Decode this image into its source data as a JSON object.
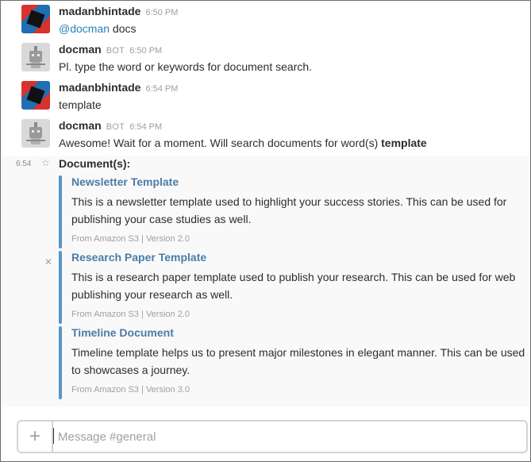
{
  "messages": [
    {
      "author": "madanbhintade",
      "time": "6:50 PM",
      "mention": "@docman",
      "text": " docs"
    },
    {
      "author": "docman",
      "badge": "BOT",
      "time": "6:50 PM",
      "text": "Pl. type the word or keywords for document search."
    },
    {
      "author": "madanbhintade",
      "time": "6:54 PM",
      "text": "template"
    },
    {
      "author": "docman",
      "badge": "BOT",
      "time": "6:54 PM",
      "text": "Awesome! Wait for a moment. Will search documents for word(s) ",
      "bold": "template"
    }
  ],
  "followup": {
    "time": "6:54",
    "star_icon": "star-icon",
    "label": "Document(s):",
    "close_icon": "close-icon"
  },
  "attachments": [
    {
      "title": "Newsletter Template",
      "description": "This is a newsletter template used to highlight your success stories. This can be used for publishing your case studies as well.",
      "footer": "From Amazon S3 | Version 2.0"
    },
    {
      "title": "Research Paper Template",
      "description": "This is a research paper template used to publish your research. This can be used for web publishing your research as well.",
      "footer": "From Amazon S3 | Version 2.0"
    },
    {
      "title": "Timeline Document",
      "description": "Timeline template helps us to present major milestones in elegant manner. This can be used to showcases a journey.",
      "footer": "From Amazon S3 | Version 3.0"
    }
  ],
  "composer": {
    "plus_label": "+",
    "placeholder": "Message #general"
  },
  "colors": {
    "accent_bar": "#5b94c5",
    "attachment_title": "#4b7ca8",
    "mention": "#2a80b9"
  }
}
